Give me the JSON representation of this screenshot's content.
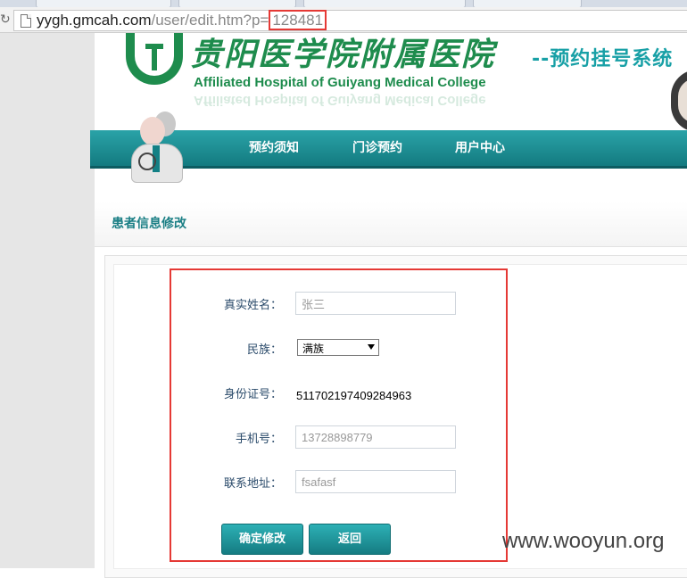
{
  "browser": {
    "url_host": "yygh.gmcah.com",
    "url_path": "/user/edit.htm?p=",
    "url_param": "128481"
  },
  "header": {
    "hospital_name_cn": "贵阳医学院附属医院",
    "hospital_name_en": "Affiliated Hospital of Guiyang Medical College",
    "system_title": "--预约挂号系统"
  },
  "nav": {
    "items": [
      "预约须知",
      "门诊预约",
      "用户中心"
    ]
  },
  "section": {
    "title": "患者信息修改"
  },
  "form": {
    "name_label": "真实姓名：",
    "name_value": "张三",
    "ethnicity_label": "民族：",
    "ethnicity_value": "满族",
    "id_label": "身份证号：",
    "id_value": "511702197409284963",
    "phone_label": "手机号：",
    "phone_value": "13728898779",
    "address_label": "联系地址：",
    "address_value": "fsafasf",
    "submit_label": "确定修改",
    "back_label": "返回"
  },
  "watermark": "www.wooyun.org",
  "colors": {
    "accent": "#1b8a90",
    "brand_green": "#1e8c4d",
    "highlight": "#e53935"
  }
}
